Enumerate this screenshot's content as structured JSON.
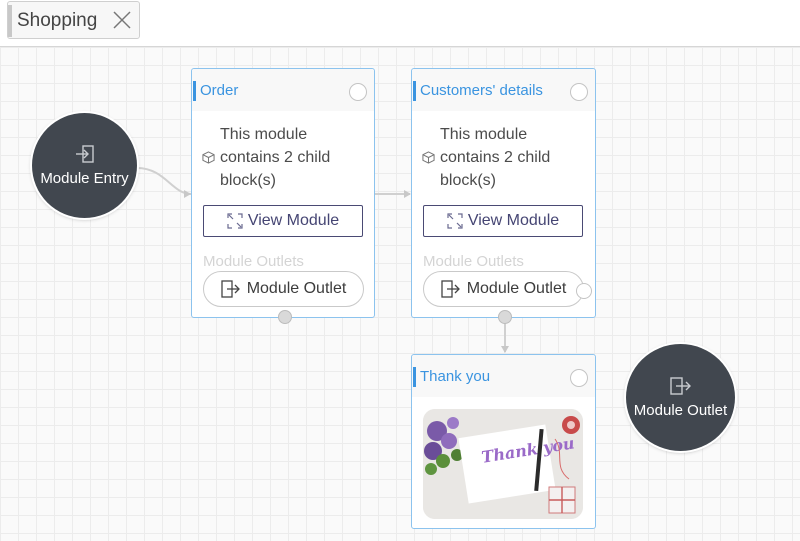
{
  "tab": {
    "label": "Shopping",
    "close_icon": "close-icon"
  },
  "entry": {
    "label": "Module Entry",
    "icon": "login-icon"
  },
  "exit": {
    "label": "Module Outlet",
    "icon": "logout-icon"
  },
  "cards": [
    {
      "title": "Order",
      "description": "This module contains 2 child block(s)",
      "view_button": "View Module",
      "outlets_label": "Module Outlets",
      "outlet_button": "Module Outlet"
    },
    {
      "title": "Customers' details",
      "description": "This module contains 2 child block(s)",
      "view_button": "View Module",
      "outlets_label": "Module Outlets",
      "outlet_button": "Module Outlet"
    },
    {
      "title": "Thank you",
      "image_text": "Thank you"
    }
  ],
  "colors": {
    "accent": "#3a94e0",
    "card_border": "#8cc3ee",
    "circle_bg": "#41474f",
    "view_button_border": "#4a4a74"
  }
}
